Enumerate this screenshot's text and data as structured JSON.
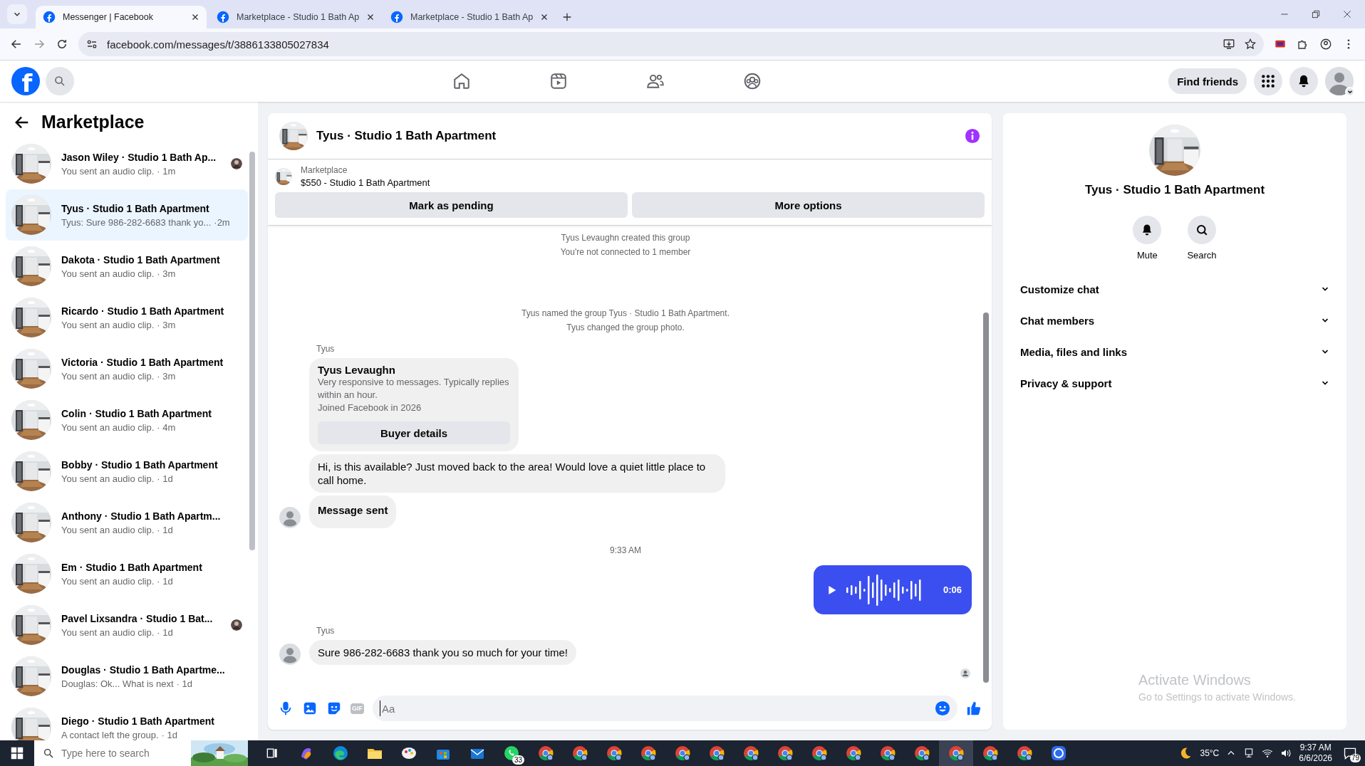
{
  "browser": {
    "tabs": [
      {
        "title": "Messenger | Facebook",
        "selected": true
      },
      {
        "title": "Marketplace - Studio 1 Bath Ap",
        "selected": false
      },
      {
        "title": "Marketplace - Studio 1 Bath Ap",
        "selected": false
      }
    ],
    "address": "facebook.com/messages/t/3886133805027834"
  },
  "top_nav": {
    "logo": "f",
    "find_friends": "Find friends"
  },
  "sidebar": {
    "title": "Marketplace",
    "conversations": [
      {
        "name": "Jason Wiley · Studio 1 Bath Ap...",
        "preview": "You sent an audio clip.",
        "time": "· 1m",
        "selected": false,
        "read_receipt": true
      },
      {
        "name": "Tyus · Studio 1 Bath Apartment",
        "preview": "Tyus: Sure 986-282-6683 thank yo...",
        "time": "·2m",
        "selected": true,
        "read_receipt": false
      },
      {
        "name": "Dakota · Studio 1 Bath Apartment",
        "preview": "You sent an audio clip.",
        "time": "· 3m",
        "selected": false,
        "read_receipt": false
      },
      {
        "name": "Ricardo · Studio 1 Bath Apartment",
        "preview": "You sent an audio clip.",
        "time": "· 3m",
        "selected": false,
        "read_receipt": false
      },
      {
        "name": "Victoria · Studio 1 Bath Apartment",
        "preview": "You sent an audio clip.",
        "time": "· 3m",
        "selected": false,
        "read_receipt": false
      },
      {
        "name": "Colin · Studio 1 Bath Apartment",
        "preview": "You sent an audio clip.",
        "time": "· 4m",
        "selected": false,
        "read_receipt": false
      },
      {
        "name": "Bobby · Studio 1 Bath Apartment",
        "preview": "You sent an audio clip.",
        "time": "· 1d",
        "selected": false,
        "read_receipt": false
      },
      {
        "name": "Anthony · Studio 1 Bath Apartm...",
        "preview": "You sent an audio clip.",
        "time": "· 1d",
        "selected": false,
        "read_receipt": false
      },
      {
        "name": "Em · Studio 1 Bath Apartment",
        "preview": "You sent an audio clip.",
        "time": "· 1d",
        "selected": false,
        "read_receipt": false
      },
      {
        "name": "Pavel Lixsandra · Studio 1 Bat...",
        "preview": "You sent an audio clip.",
        "time": "· 1d",
        "selected": false,
        "read_receipt": true
      },
      {
        "name": "Douglas · Studio 1 Bath Apartme...",
        "preview": "Douglas: Ok... What is next",
        "time": "· 1d",
        "selected": false,
        "read_receipt": false
      },
      {
        "name": "Diego · Studio 1 Bath Apartment",
        "preview": "A contact left the group.",
        "time": "· 1d",
        "selected": false,
        "read_receipt": false
      }
    ]
  },
  "chat": {
    "title": "Tyus · Studio 1 Bath Apartment",
    "listing": {
      "label": "Marketplace",
      "item": "$550 - Studio 1 Bath Apartment",
      "buttons": [
        "Mark as pending",
        "More options"
      ]
    },
    "messages": [
      {
        "kind": "system",
        "text": "Tyus Levaughn created this group"
      },
      {
        "kind": "system",
        "text": "You're not connected to 1 member"
      },
      {
        "kind": "spacer"
      },
      {
        "kind": "system",
        "text": "Tyus named the group Tyus · Studio 1 Bath Apartment."
      },
      {
        "kind": "system",
        "text": "Tyus changed the group photo."
      },
      {
        "kind": "sender",
        "text": "Tyus"
      },
      {
        "kind": "profile_card",
        "name": "Tyus Levaughn",
        "lines": [
          "Very responsive to messages. Typically replies within an hour.",
          "Joined Facebook in 2026"
        ],
        "button": "Buyer details"
      },
      {
        "kind": "incoming",
        "text": "Hi, is this available? Just moved back to the area! Would love a quiet little place to call home.",
        "avatar": false
      },
      {
        "kind": "notice",
        "text": "Message sent",
        "avatar": true
      },
      {
        "kind": "time",
        "text": "9:33 AM"
      },
      {
        "kind": "audio_out",
        "duration": "0:06"
      },
      {
        "kind": "sender",
        "text": "Tyus"
      },
      {
        "kind": "incoming",
        "text": "Sure 986-282-6683 thank you so much for your time!",
        "avatar": true
      }
    ],
    "composer": {
      "gif": "GIF",
      "placeholder": "Aa"
    }
  },
  "details": {
    "title": "Tyus · Studio 1 Bath Apartment",
    "actions": [
      {
        "kind": "mute",
        "label": "Mute"
      },
      {
        "kind": "search",
        "label": "Search"
      }
    ],
    "sections": [
      {
        "label": "Customize chat",
        "expanded": false
      },
      {
        "label": "Chat members",
        "expanded": false
      },
      {
        "label": "Media, files and links",
        "expanded": false
      },
      {
        "label": "Privacy & support",
        "expanded": false
      }
    ]
  },
  "activation": {
    "title": "Activate Windows",
    "hint": "Go to Settings to activate Windows."
  },
  "taskbar": {
    "search_placeholder": "Type here to search",
    "apps": [
      {
        "kind": "taskview",
        "selected": false
      },
      {
        "kind": "copilot",
        "selected": false
      },
      {
        "kind": "edge",
        "selected": false
      },
      {
        "kind": "folder",
        "selected": false
      },
      {
        "kind": "paint",
        "selected": false
      },
      {
        "kind": "store",
        "selected": false
      },
      {
        "kind": "mail",
        "selected": false
      },
      {
        "kind": "whatsapp",
        "selected": false,
        "badge": "33"
      },
      {
        "kind": "chrome",
        "selected": false
      },
      {
        "kind": "chrome",
        "selected": false
      },
      {
        "kind": "chrome",
        "selected": false
      },
      {
        "kind": "chrome",
        "selected": false
      },
      {
        "kind": "chrome",
        "selected": false
      },
      {
        "kind": "chrome",
        "selected": false
      },
      {
        "kind": "chrome",
        "selected": false
      },
      {
        "kind": "chrome",
        "selected": false
      },
      {
        "kind": "chrome",
        "selected": false
      },
      {
        "kind": "chrome",
        "selected": false
      },
      {
        "kind": "chrome",
        "selected": false
      },
      {
        "kind": "chrome",
        "selected": false
      },
      {
        "kind": "chrome",
        "selected": true
      },
      {
        "kind": "chrome",
        "selected": false
      },
      {
        "kind": "chrome",
        "selected": false
      },
      {
        "kind": "signal",
        "selected": false
      }
    ],
    "weather": "35°C",
    "time": "9:37 AM",
    "date": "6/6/2026",
    "notifications": "79"
  }
}
